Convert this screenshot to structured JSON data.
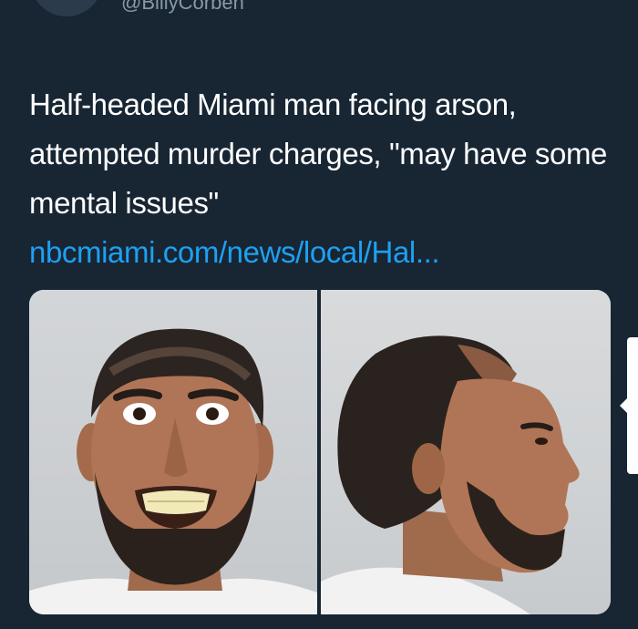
{
  "tweet": {
    "handle": "@BillyCorben",
    "text_plain": "Half-headed Miami man facing arson, attempted murder charges, \"may have some mental issues\" ",
    "link_text": "nbcmiami.com/news/local/Hal..."
  },
  "media": {
    "photos": [
      {
        "description_name": "mugshot-front-photo"
      },
      {
        "description_name": "mugshot-profile-photo"
      }
    ]
  },
  "colors": {
    "background": "#15202b",
    "text": "#ffffff",
    "link": "#1da1f2",
    "handle": "#8899a6"
  }
}
